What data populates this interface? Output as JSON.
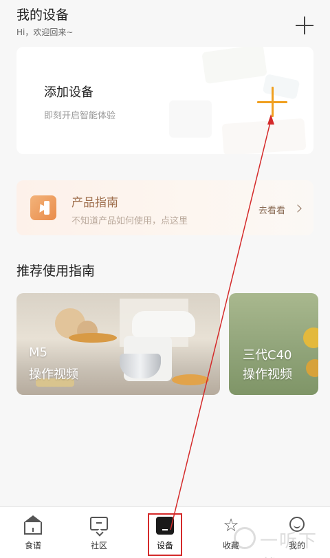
{
  "header": {
    "title": "我的设备",
    "subtitle": "Hi，欢迎回来~"
  },
  "add_device": {
    "title": "添加设备",
    "subtitle": "即刻开启智能体验"
  },
  "product_guide": {
    "title": "产品指南",
    "subtitle": "不知道产品如何使用，点这里",
    "link_label": "去看看"
  },
  "recommended": {
    "title": "推荐使用指南",
    "videos": [
      {
        "line1": "M5",
        "line2": "操作视频"
      },
      {
        "line1": "三代C40",
        "line2": "操作视频"
      }
    ]
  },
  "tabbar": {
    "items": [
      {
        "label": "食谱",
        "icon": "home-icon"
      },
      {
        "label": "社区",
        "icon": "chat-icon"
      },
      {
        "label": "设备",
        "icon": "device-icon",
        "active": true
      },
      {
        "label": "收藏",
        "icon": "star-icon"
      },
      {
        "label": "我的",
        "icon": "profile-icon"
      }
    ]
  },
  "watermark": {
    "text": "一听下载"
  },
  "colors": {
    "accent": "#f0a020",
    "guide_text": "#a0704e",
    "annotation": "#d42a2a"
  }
}
